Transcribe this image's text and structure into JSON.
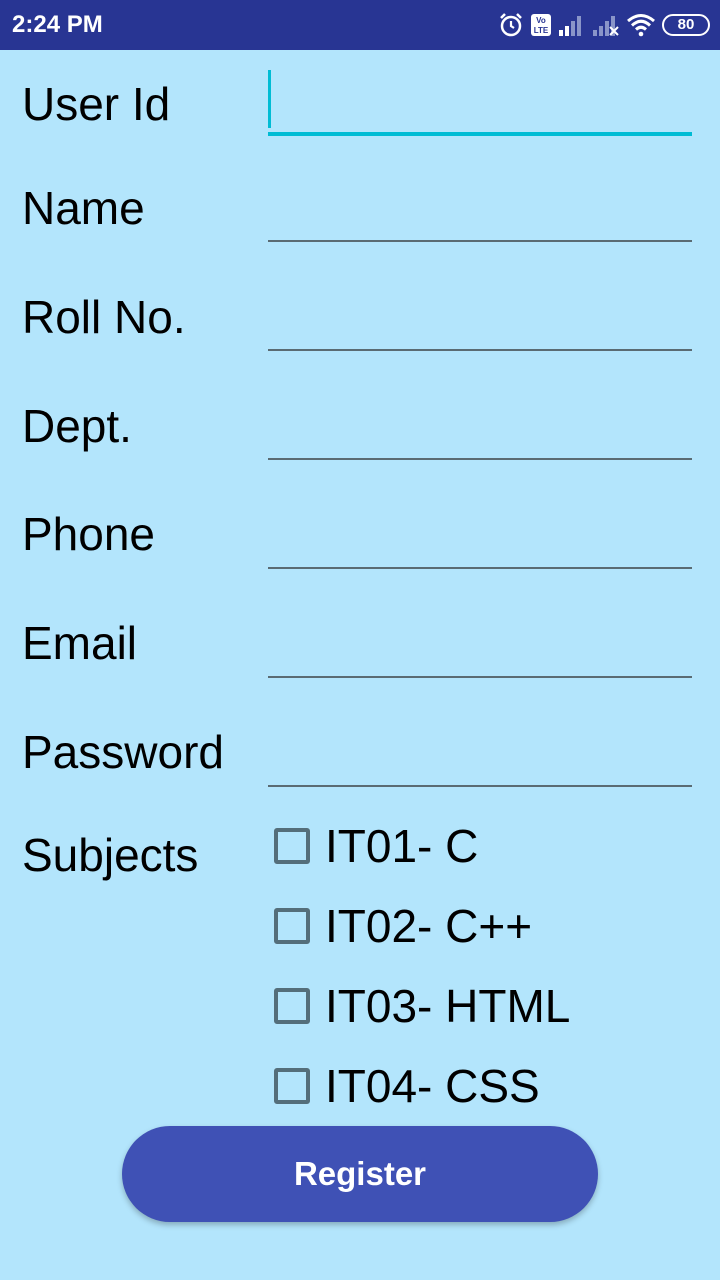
{
  "status_bar": {
    "time": "2:24 PM",
    "battery": "80",
    "icons": [
      "alarm-icon",
      "volte-icon",
      "signal-icon",
      "signal-no-service-icon",
      "wifi-icon",
      "battery-icon"
    ]
  },
  "form": {
    "fields": [
      {
        "label": "User Id",
        "value": "",
        "placeholder": ""
      },
      {
        "label": "Name",
        "value": "",
        "placeholder": ""
      },
      {
        "label": "Roll No.",
        "value": "",
        "placeholder": ""
      },
      {
        "label": "Dept.",
        "value": "",
        "placeholder": ""
      },
      {
        "label": "Phone",
        "value": "",
        "placeholder": ""
      },
      {
        "label": "Email",
        "value": "",
        "placeholder": ""
      },
      {
        "label": "Password",
        "value": "",
        "placeholder": ""
      }
    ],
    "subjects_label": "Subjects",
    "subjects": [
      {
        "label": "IT01- C",
        "checked": false
      },
      {
        "label": "IT02- C++",
        "checked": false
      },
      {
        "label": "IT03- HTML",
        "checked": false
      },
      {
        "label": "IT04- CSS",
        "checked": false
      }
    ],
    "register_label": "Register"
  },
  "colors": {
    "background": "#b3e5fc",
    "status_bar": "#283593",
    "accent": "#00bcd4",
    "button": "#3f51b5"
  }
}
